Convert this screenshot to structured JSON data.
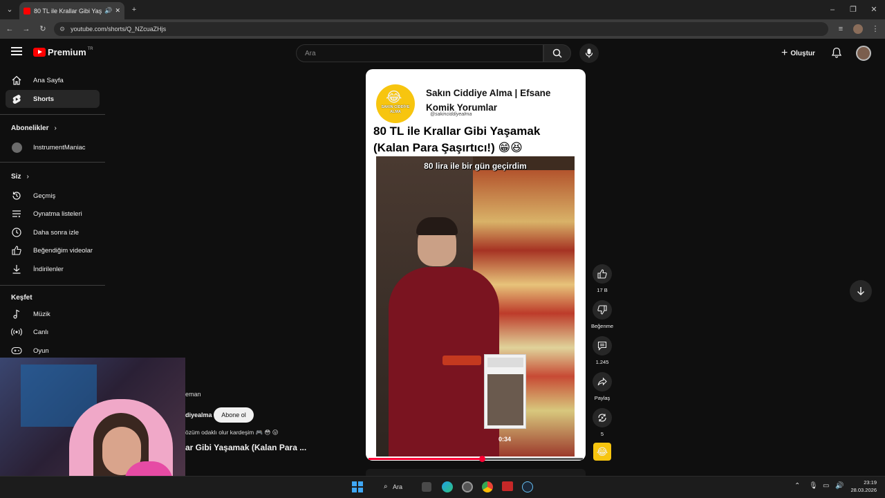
{
  "browser": {
    "tab_title": "80 TL ile Krallar Gibi Yaşam...",
    "url": "youtube.com/shorts/Q_NZcuaZHjs"
  },
  "header": {
    "logo_text": "Premium",
    "logo_region": "TR",
    "search_placeholder": "Ara",
    "create_label": "Oluştur"
  },
  "sidebar": {
    "top": [
      {
        "label": "Ana Sayfa",
        "icon": "home-icon"
      },
      {
        "label": "Shorts",
        "icon": "shorts-icon",
        "active": true
      }
    ],
    "subs_heading": "Abonelikler",
    "subscriptions": [
      {
        "label": "InstrumentManiac"
      }
    ],
    "you_heading": "Siz",
    "you": [
      {
        "label": "Geçmiş",
        "icon": "history-icon"
      },
      {
        "label": "Oynatma listeleri",
        "icon": "playlist-icon"
      },
      {
        "label": "Daha sonra izle",
        "icon": "clock-icon"
      },
      {
        "label": "Beğendiğim videolar",
        "icon": "thumb-up-icon"
      },
      {
        "label": "İndirilenler",
        "icon": "download-icon"
      }
    ],
    "explore_heading": "Keşfet",
    "explore": [
      {
        "label": "Müzik",
        "icon": "music-icon"
      },
      {
        "label": "Canlı",
        "icon": "live-icon"
      },
      {
        "label": "Oyun",
        "icon": "gaming-icon"
      }
    ]
  },
  "short": {
    "channel_title": "Sakın Ciddiye Alma | Efsane Komik Yorumlar",
    "channel_handle": "@sakinciddiyealma",
    "logo_text": "SAKIN CİDDİYE ALMA",
    "video_title": "80 TL ile Krallar Gibi Yaşamak (Kalan Para Şaşırtıcı!) 😁😆",
    "caption": "80 lira ile bir gün geçirdim",
    "preview_time": "0:34",
    "progress": 0.53
  },
  "actions": {
    "likes": "17 B",
    "dislike_label": "Beğenme",
    "comments": "1.245",
    "share_label": "Paylaş",
    "remix_count": "5"
  },
  "overlay": {
    "line1": "eman",
    "channel": "diyealma",
    "subscribe_label": "Abone ol",
    "description": "özüm odaklı olur kardeşim 🎮 😳 😛",
    "title": "ar Gibi Yaşamak (Kalan Para ..."
  },
  "taskbar": {
    "search_label": "Ara",
    "time": "23:19",
    "date": "28.03.2026"
  }
}
